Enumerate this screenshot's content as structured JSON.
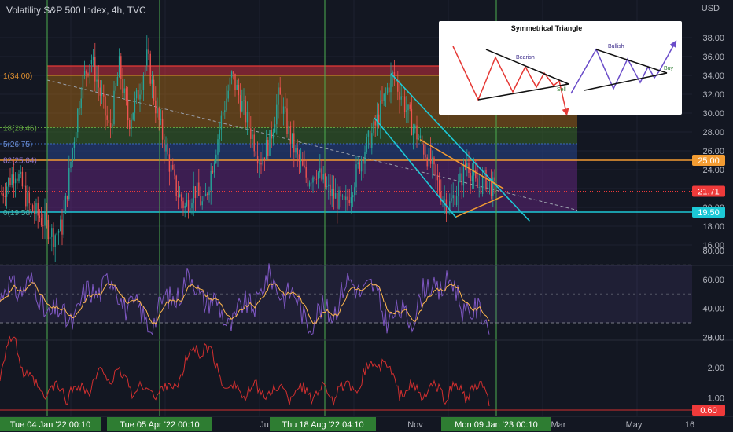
{
  "header": {
    "title": "Volatility S&P 500 Index, 4h, TVC",
    "currency": "USD"
  },
  "colors": {
    "bg": "#131722",
    "grid": "#1e2230",
    "axis_text": "#b2b5be",
    "candle_up": "#26a69a",
    "candle_down": "#ef5350",
    "vline": "#4caf50",
    "resist": "#f39c32",
    "support": "#1cc9d6",
    "rsi": "#7e57c2",
    "rsi_ma": "#ffb74d",
    "lower": "#d32f2f"
  },
  "price_axis": {
    "ticks": [
      "38.00",
      "36.00",
      "34.00",
      "32.00",
      "30.00",
      "28.00",
      "26.00",
      "24.00",
      "22.00",
      "20.00",
      "18.00",
      "16.00"
    ],
    "badges": [
      {
        "value": "25.00",
        "color": "#f39c32"
      },
      {
        "value": "21.71",
        "color": "#ef3a3a"
      },
      {
        "value": "19.50",
        "color": "#1cc9d6"
      }
    ]
  },
  "fib_labels": [
    "1(34.00)",
    "18(28.46)",
    "5(26.75)",
    "82(25.04)",
    "0(19.50)"
  ],
  "rsi_axis": {
    "ticks": [
      "80.00",
      "60.00",
      "40.00",
      "20.00"
    ]
  },
  "lower_axis": {
    "ticks": [
      "3.00",
      "2.00",
      "1.00"
    ],
    "badge": "0.60"
  },
  "time_axis": {
    "labels": [
      "Ju",
      "Nov",
      "Mar",
      "May",
      "16"
    ],
    "highlights": [
      "Tue 04 Jan '22  00:10",
      "Tue 05 Apr '22  00:10",
      "Thu 18 Aug '22  04:10",
      "Mon 09 Jan '23  00:10"
    ]
  },
  "inset": {
    "title": "Symmetrical Triangle",
    "bearish": "Bearish",
    "sell": "Sell",
    "bullish": "Bullish",
    "buy": "Buy"
  },
  "chart_data": {
    "type": "candlestick",
    "title": "Volatility S&P 500 Index, 4h, TVC",
    "ylim": [
      15,
      40
    ],
    "key_levels": {
      "resistance": 25.0,
      "current": 21.71,
      "support": 19.5
    },
    "fib_levels": [
      34.0,
      28.46,
      26.75,
      25.04,
      19.5
    ],
    "series_approx": [
      {
        "t": 0,
        "v": 21.5
      },
      {
        "t": 3,
        "v": 24
      },
      {
        "t": 6,
        "v": 20
      },
      {
        "t": 9,
        "v": 18.5
      },
      {
        "t": 11,
        "v": 17
      },
      {
        "t": 13,
        "v": 18
      },
      {
        "t": 15,
        "v": 26
      },
      {
        "t": 17,
        "v": 33
      },
      {
        "t": 19,
        "v": 36
      },
      {
        "t": 21,
        "v": 32
      },
      {
        "t": 23,
        "v": 28
      },
      {
        "t": 25,
        "v": 35
      },
      {
        "t": 27,
        "v": 29
      },
      {
        "t": 29,
        "v": 32
      },
      {
        "t": 31,
        "v": 36
      },
      {
        "t": 33,
        "v": 30
      },
      {
        "t": 35,
        "v": 26
      },
      {
        "t": 37,
        "v": 22
      },
      {
        "t": 39,
        "v": 20
      },
      {
        "t": 41,
        "v": 22
      },
      {
        "t": 43,
        "v": 20
      },
      {
        "t": 45,
        "v": 25
      },
      {
        "t": 47,
        "v": 30
      },
      {
        "t": 49,
        "v": 34
      },
      {
        "t": 51,
        "v": 31
      },
      {
        "t": 53,
        "v": 28
      },
      {
        "t": 55,
        "v": 25
      },
      {
        "t": 57,
        "v": 27
      },
      {
        "t": 59,
        "v": 32
      },
      {
        "t": 61,
        "v": 28
      },
      {
        "t": 63,
        "v": 25
      },
      {
        "t": 65,
        "v": 23
      },
      {
        "t": 67,
        "v": 24
      },
      {
        "t": 69,
        "v": 22
      },
      {
        "t": 71,
        "v": 21
      },
      {
        "t": 73,
        "v": 20
      },
      {
        "t": 75,
        "v": 23
      },
      {
        "t": 77,
        "v": 26
      },
      {
        "t": 79,
        "v": 28
      },
      {
        "t": 81,
        "v": 31
      },
      {
        "t": 83,
        "v": 34
      },
      {
        "t": 85,
        "v": 32
      },
      {
        "t": 87,
        "v": 29
      },
      {
        "t": 89,
        "v": 27
      },
      {
        "t": 91,
        "v": 25
      },
      {
        "t": 93,
        "v": 22
      },
      {
        "t": 95,
        "v": 20
      },
      {
        "t": 97,
        "v": 22
      },
      {
        "t": 99,
        "v": 25
      },
      {
        "t": 101,
        "v": 22
      },
      {
        "t": 103,
        "v": 23
      },
      {
        "t": 105,
        "v": 21.7
      }
    ]
  }
}
